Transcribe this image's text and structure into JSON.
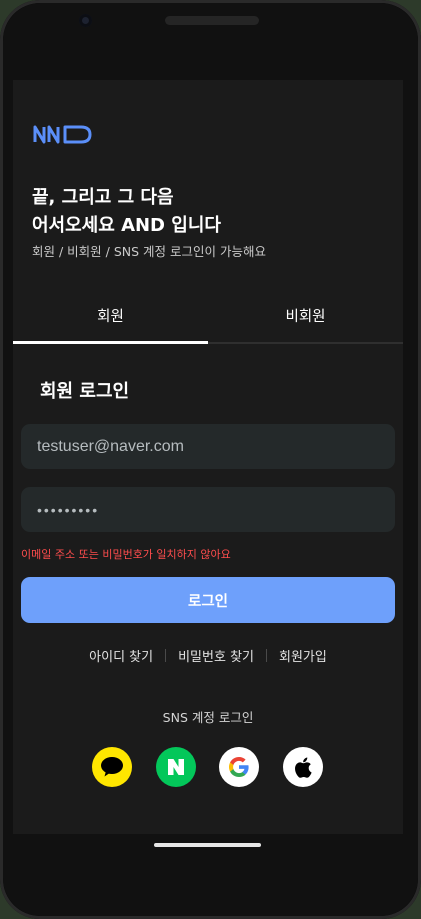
{
  "header": {
    "headline_line1": "끝, 그리고 그 다음",
    "headline_line2": "어서오세요 AND 입니다",
    "subtitle": "회원 / 비회원 / SNS 계정 로그인이 가능해요"
  },
  "logo": {
    "text": "AND",
    "color": "#5b8ff9"
  },
  "tabs": [
    {
      "label": "회원",
      "active": true
    },
    {
      "label": "비회원",
      "active": false
    }
  ],
  "login_form": {
    "title": "회원 로그인",
    "email_value": "testuser@naver.com",
    "password_value": "•••••••••",
    "error_message": "이메일 주소 또는 비밀번호가 일치하지 않아요",
    "submit_label": "로그인"
  },
  "links": {
    "find_id": "아이디 찾기",
    "find_password": "비밀번호 찾기",
    "signup": "회원가입"
  },
  "sns": {
    "label": "SNS 계정 로그인",
    "providers": [
      {
        "name": "kakao",
        "icon": "kakao-speech-bubble-icon",
        "color": "#ffe600"
      },
      {
        "name": "naver",
        "icon": "naver-n-icon",
        "color": "#03c75a"
      },
      {
        "name": "google",
        "icon": "google-g-icon",
        "color": "#ffffff"
      },
      {
        "name": "apple",
        "icon": "apple-icon",
        "color": "#ffffff"
      }
    ]
  },
  "colors": {
    "accent": "#6ea0fb",
    "error": "#ff4d4d",
    "background": "#1b1b1b"
  }
}
